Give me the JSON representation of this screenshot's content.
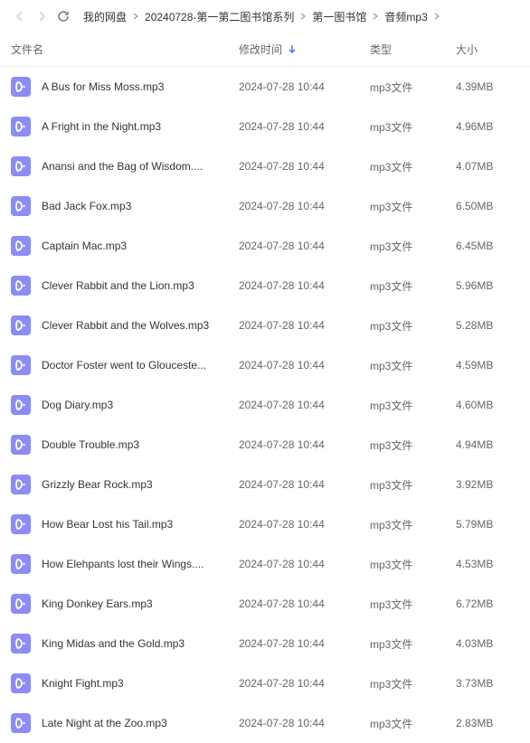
{
  "breadcrumb": [
    {
      "label": "我的网盘"
    },
    {
      "label": "20240728-第一第二图书馆系列"
    },
    {
      "label": "第一图书馆"
    },
    {
      "label": "音频mp3"
    }
  ],
  "columns": {
    "name": "文件名",
    "time": "修改时间",
    "type": "类型",
    "size": "大小"
  },
  "files": [
    {
      "name": "A Bus for Miss Moss.mp3",
      "time": "2024-07-28 10:44",
      "type": "mp3文件",
      "size": "4.39MB"
    },
    {
      "name": "A Fright in the Night.mp3",
      "time": "2024-07-28 10:44",
      "type": "mp3文件",
      "size": "4.96MB"
    },
    {
      "name": "Anansi and the Bag of Wisdom....",
      "time": "2024-07-28 10:44",
      "type": "mp3文件",
      "size": "4.07MB"
    },
    {
      "name": "Bad Jack Fox.mp3",
      "time": "2024-07-28 10:44",
      "type": "mp3文件",
      "size": "6.50MB"
    },
    {
      "name": "Captain Mac.mp3",
      "time": "2024-07-28 10:44",
      "type": "mp3文件",
      "size": "6.45MB"
    },
    {
      "name": "Clever Rabbit and the Lion.mp3",
      "time": "2024-07-28 10:44",
      "type": "mp3文件",
      "size": "5.96MB"
    },
    {
      "name": "Clever Rabbit and the Wolves.mp3",
      "time": "2024-07-28 10:44",
      "type": "mp3文件",
      "size": "5.28MB"
    },
    {
      "name": "Doctor Foster went to Glouceste...",
      "time": "2024-07-28 10:44",
      "type": "mp3文件",
      "size": "4.59MB"
    },
    {
      "name": "Dog Diary.mp3",
      "time": "2024-07-28 10:44",
      "type": "mp3文件",
      "size": "4.60MB"
    },
    {
      "name": "Double Trouble.mp3",
      "time": "2024-07-28 10:44",
      "type": "mp3文件",
      "size": "4.94MB"
    },
    {
      "name": "Grizzly Bear Rock.mp3",
      "time": "2024-07-28 10:44",
      "type": "mp3文件",
      "size": "3.92MB"
    },
    {
      "name": "How Bear Lost his Tail.mp3",
      "time": "2024-07-28 10:44",
      "type": "mp3文件",
      "size": "5.79MB"
    },
    {
      "name": "How Elehpants lost their Wings....",
      "time": "2024-07-28 10:44",
      "type": "mp3文件",
      "size": "4.53MB"
    },
    {
      "name": "King Donkey Ears.mp3",
      "time": "2024-07-28 10:44",
      "type": "mp3文件",
      "size": "6.72MB"
    },
    {
      "name": "King Midas and the Gold.mp3",
      "time": "2024-07-28 10:44",
      "type": "mp3文件",
      "size": "4.03MB"
    },
    {
      "name": "Knight Fight.mp3",
      "time": "2024-07-28 10:44",
      "type": "mp3文件",
      "size": "3.73MB"
    },
    {
      "name": "Late Night at the Zoo.mp3",
      "time": "2024-07-28 10:44",
      "type": "mp3文件",
      "size": "2.83MB"
    }
  ]
}
